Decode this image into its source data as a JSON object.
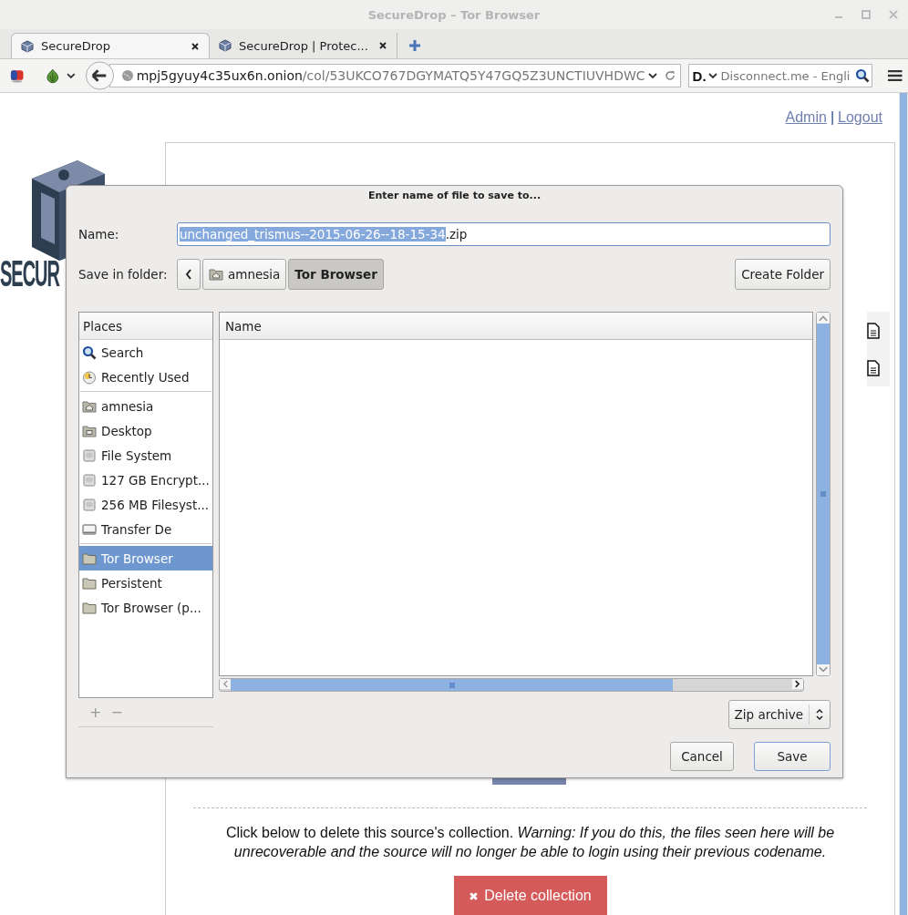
{
  "window": {
    "title": "SecureDrop – Tor Browser"
  },
  "tabs": [
    {
      "label": "SecureDrop",
      "selected": true
    },
    {
      "label": "SecureDrop | Protec...",
      "selected": false
    }
  ],
  "toolbar": {
    "url_host": "mpj5gyuy4c35ux6n.onion",
    "url_path": "/col/53UKCO767DGYMATQ5Y47GQ5Z3UNCTIUVHDWC",
    "search_engine": "D.",
    "search_placeholder": "Disconnect.me - Engli"
  },
  "page": {
    "header_links": [
      "Admin",
      "Logout"
    ],
    "separator": "|",
    "logo_text": "SECUR",
    "delete_notice": "Click below to delete this source's collection. *Warning: If you do this, the files seen here will be unrecoverable and the source will no longer be able to login using their previous codename.*",
    "delete_button": "Delete collection"
  },
  "dialog": {
    "title": "Enter name of file to save to...",
    "name_label": "Name:",
    "name_value": {
      "selected": "unchanged_trismus--2015-06-26--18-15-34",
      "rest": ".zip"
    },
    "folder_label": "Save in folder:",
    "path": [
      {
        "label": "amnesia",
        "kind": "home",
        "selected": false
      },
      {
        "label": "Tor Browser",
        "kind": "plain",
        "selected": true
      }
    ],
    "create_folder": "Create Folder",
    "places_header": "Places",
    "places": [
      [
        {
          "label": "Search",
          "kind": "search",
          "selected": false
        },
        {
          "label": "Recently Used",
          "kind": "recent",
          "selected": false
        }
      ],
      [
        {
          "label": "amnesia",
          "kind": "home",
          "selected": false
        },
        {
          "label": "Desktop",
          "kind": "desktop",
          "selected": false
        },
        {
          "label": "File System",
          "kind": "drive",
          "selected": false
        },
        {
          "label": "127 GB Encrypt...",
          "kind": "drive",
          "selected": false
        },
        {
          "label": "256 MB Filesyst...",
          "kind": "drive",
          "selected": false
        },
        {
          "label": "Transfer De",
          "kind": "device",
          "selected": false
        }
      ],
      [
        {
          "label": "Tor Browser",
          "kind": "folder",
          "selected": true
        },
        {
          "label": "Persistent",
          "kind": "folder",
          "selected": false
        },
        {
          "label": "Tor Browser (p...",
          "kind": "folder",
          "selected": false
        }
      ]
    ],
    "place_actions": [
      {
        "label": "+",
        "disabled": true
      },
      {
        "label": "−",
        "disabled": true
      }
    ],
    "files_header": "Name",
    "filter": "Zip archive",
    "buttons": [
      "Cancel",
      "Save"
    ]
  }
}
